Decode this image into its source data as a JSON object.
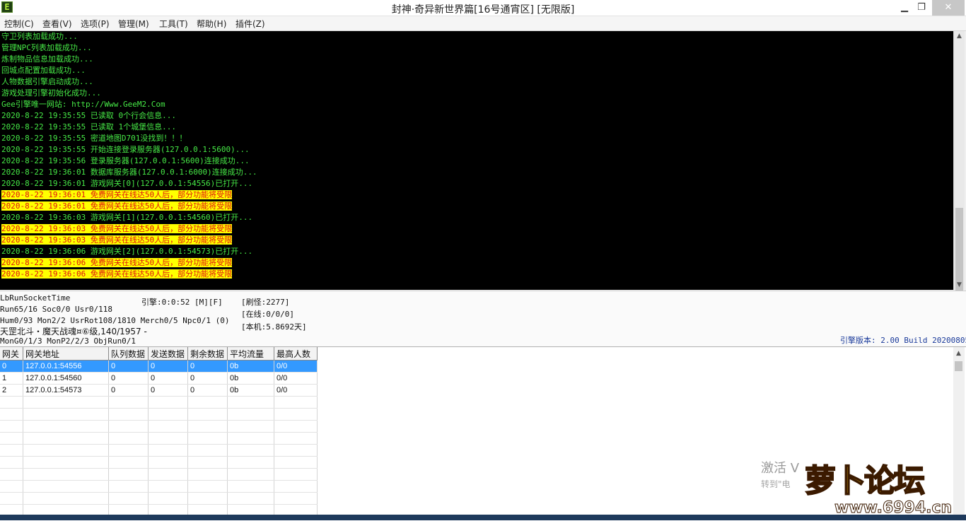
{
  "window": {
    "title": "封神·奇异新世界篇[16号通宵区] [无限版]",
    "minimize": "▁",
    "restore": "❐",
    "close": "✕"
  },
  "menu": [
    "控制(C)",
    "查看(V)",
    "选项(P)",
    "管理(M)",
    "工具(T)",
    "帮助(H)",
    "插件(Z)"
  ],
  "log": [
    {
      "text": "守卫列表加载成功...",
      "warn": false
    },
    {
      "text": "管理NPC列表加载成功...",
      "warn": false
    },
    {
      "text": "炼制物品信息加载成功...",
      "warn": false
    },
    {
      "text": "回城点配置加载成功...",
      "warn": false
    },
    {
      "text": "人物数据引擎启动成功...",
      "warn": false
    },
    {
      "text": "游戏处理引擎初始化成功...",
      "warn": false
    },
    {
      "text": "Gee引擎唯一网站: http://Www.GeeM2.Com",
      "warn": false
    },
    {
      "text": "2020-8-22 19:35:55 已读取 0个行会信息...",
      "warn": false
    },
    {
      "text": "2020-8-22 19:35:55 已读取 1个城堡信息...",
      "warn": false
    },
    {
      "text": "2020-8-22 19:35:55 密道地图D701没找到！！！",
      "warn": false
    },
    {
      "text": "2020-8-22 19:35:55 开始连接登录服务器(127.0.0.1:5600)...",
      "warn": false
    },
    {
      "text": "2020-8-22 19:35:56 登录服务器(127.0.0.1:5600)连接成功...",
      "warn": false
    },
    {
      "text": "2020-8-22 19:36:01 数据库服务器(127.0.0.1:6000)连接成功...",
      "warn": false
    },
    {
      "text": "2020-8-22 19:36:01 游戏网关[0](127.0.0.1:54556)已打开...",
      "warn": false
    },
    {
      "text": "2020-8-22 19:36:01 免费网关在线达50人后，部分功能将受限",
      "warn": true
    },
    {
      "text": "2020-8-22 19:36:01 免费网关在线达50人后，部分功能将受限",
      "warn": true
    },
    {
      "text": "2020-8-22 19:36:03 游戏网关[1](127.0.0.1:54560)已打开...",
      "warn": false
    },
    {
      "text": "2020-8-22 19:36:03 免费网关在线达50人后，部分功能将受限",
      "warn": true
    },
    {
      "text": "2020-8-22 19:36:03 免费网关在线达50人后，部分功能将受限",
      "warn": true
    },
    {
      "text": "2020-8-22 19:36:06 游戏网关[2](127.0.0.1:54573)已打开...",
      "warn": false
    },
    {
      "text": "2020-8-22 19:36:06 免费网关在线达50人后，部分功能将受限",
      "warn": true
    },
    {
      "text": "2020-8-22 19:36:06 免费网关在线达50人后，部分功能将受限",
      "warn": true
    }
  ],
  "status": {
    "socket_time": "LbRunSocketTime",
    "run_line": "Run65/16 Soc0/0 Usr0/118",
    "hum_line": "Hum0/93 Mon2/2 UsrRot108/1810 Merch0/5 Npc0/1 (0)",
    "map_line": "天罡北斗・魔天战魂¤⑥级,140/1957 -",
    "mon_line": "MonG0/1/3 MonP2/2/3 ObjRun0/1",
    "engine_time": "引擎:0:0:52 [M][F]",
    "refresh_monsters": "[刷怪:2277]",
    "online": "[在线:0/0/0]",
    "local_days": "[本机:5.8692天]",
    "engine_version": "引擎版本: 2.00 Build 20200805"
  },
  "table": {
    "columns": [
      "网关",
      "网关地址",
      "队列数据",
      "发送数据",
      "剩余数据",
      "平均流量",
      "最高人数"
    ],
    "rows": [
      [
        "0",
        "127.0.0.1:54556",
        "0",
        "0",
        "0",
        "0b",
        "0/0"
      ],
      [
        "1",
        "127.0.0.1:54560",
        "0",
        "0",
        "0",
        "0b",
        "0/0"
      ],
      [
        "2",
        "127.0.0.1:54573",
        "0",
        "0",
        "0",
        "0b",
        "0/0"
      ]
    ],
    "selected_row": 0,
    "empty_rows": 10
  },
  "overlay": {
    "activate_text": "激活 V",
    "activate_sub": "转到\"电",
    "logo_text": "萝卜论坛",
    "logo_url": "www.6994.cn"
  },
  "colors": {
    "log_bg": "#000000",
    "log_text": "#46e846",
    "warn_bg": "#ffff00",
    "warn_text": "#e01010",
    "selection": "#3399ff"
  }
}
